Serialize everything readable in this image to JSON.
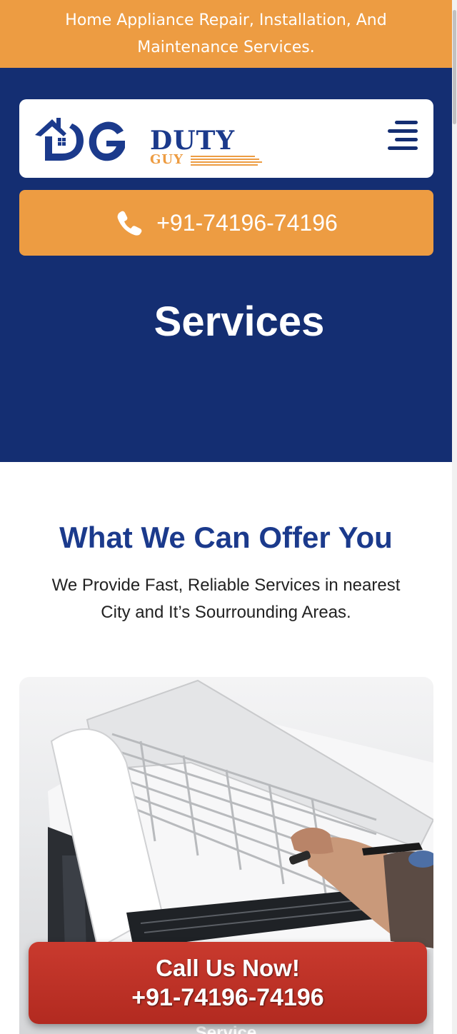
{
  "topbar": {
    "text": "Home Appliance Repair, Installation, And Maintenance Services."
  },
  "logo": {
    "duty": "DUTY",
    "guy": "GUY"
  },
  "header": {
    "phone_label": "+91-74196-74196"
  },
  "hero": {
    "title": "Services"
  },
  "offer": {
    "title": "What We Can Offer You",
    "subtitle": "We Provide Fast, Reliable Services in nearest City and It’s Sourrounding Areas."
  },
  "service_card": {
    "label": "Service"
  },
  "call_now": {
    "line1": "Call Us Now!",
    "line2": "+91-74196-74196"
  },
  "colors": {
    "brand_orange": "#ED9C42",
    "brand_navy": "#142E72",
    "title_blue": "#1B3A8C",
    "call_red": "#B22A20"
  },
  "icons": {
    "menu": "hamburger-menu-icon",
    "phone": "phone-icon"
  }
}
